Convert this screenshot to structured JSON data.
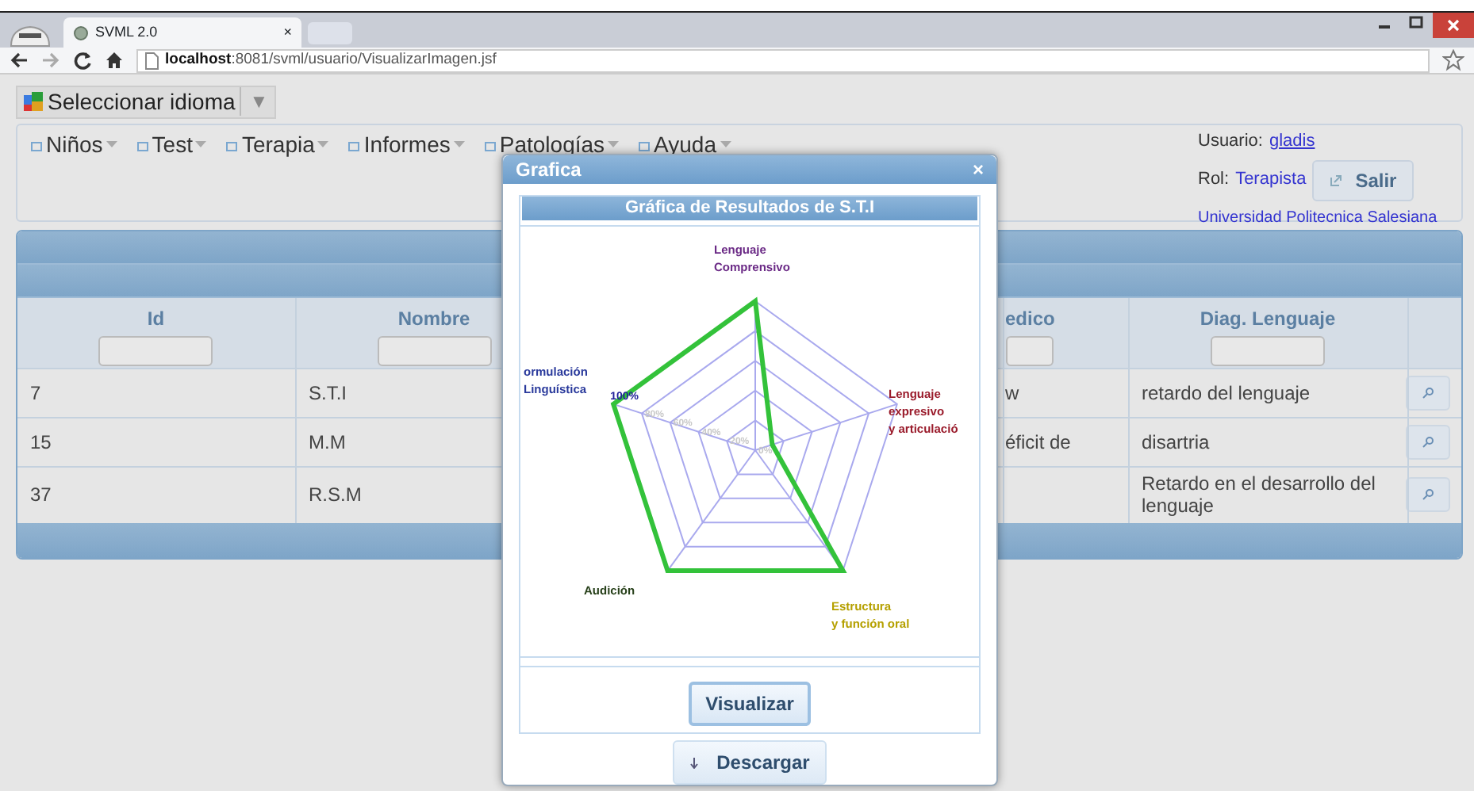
{
  "browser": {
    "tab_title": "SVML 2.0",
    "tab_close": "×",
    "address": "**localhost**:8081/svml/usuario/VisualizarImagen.jsf"
  },
  "language_selector": {
    "label": "Seleccionar idioma",
    "arrow": "▼"
  },
  "menu": [
    {
      "label": "Niños"
    },
    {
      "label": "Test"
    },
    {
      "label": "Terapia"
    },
    {
      "label": "Informes"
    },
    {
      "label": "Patologías"
    },
    {
      "label": "Ayuda"
    }
  ],
  "user_panel": {
    "user_label": "Usuario:",
    "user_name": "gladis",
    "role_label": "Rol:",
    "role": "Terapista",
    "logout": "Salir",
    "institution": "Universidad Politecnica Salesiana"
  },
  "table": {
    "columns": [
      "Id",
      "Nombre",
      "",
      "edico",
      "Diag. Lenguaje",
      ""
    ],
    "rows": [
      {
        "cells": [
          "7",
          "S.T.I",
          "",
          "w",
          "retardo del lenguaje"
        ]
      },
      {
        "cells": [
          "15",
          "M.M",
          "",
          "éficit de",
          "disartria"
        ]
      },
      {
        "cells": [
          "37",
          "R.S.M",
          "",
          "",
          "Retardo en el desarrollo del lenguaje"
        ]
      }
    ]
  },
  "dialog": {
    "title": "Grafica",
    "close": "×",
    "chart_title": "Gráfica de Resultados de S.T.I",
    "axes": [
      {
        "label": "Lenguaje\nComprensivo",
        "color": "#6b2a86"
      },
      {
        "label": "Lenguaje\nexpresivo\ny articulació",
        "color": "#9a1b2b"
      },
      {
        "label": "Estructura\ny función oral",
        "color": "#b5a000"
      },
      {
        "label": "Audición",
        "color": "#27401a"
      },
      {
        "label": "ormulación\nLinguística",
        "color": "#2a3a9c"
      }
    ],
    "ticks": [
      "100%",
      "80%",
      "60%",
      "40%",
      "20%",
      "0%"
    ],
    "buttons": [
      {
        "label": "Visualizar",
        "kind": "primary"
      },
      {
        "label": "Descargar",
        "kind": "download"
      }
    ]
  }
}
